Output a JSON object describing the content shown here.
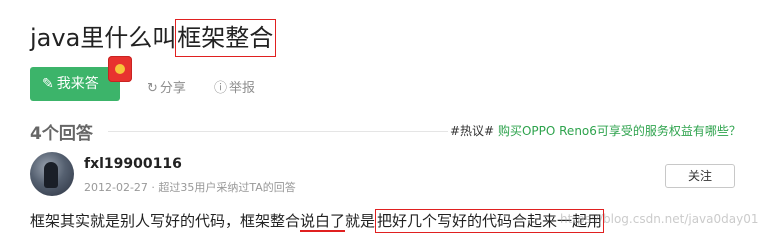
{
  "question": {
    "title_prefix": "java里什么叫",
    "title_highlight": "框架整合"
  },
  "actions": {
    "answer_label": "我来答",
    "share_label": "分享",
    "report_label": "举报"
  },
  "answers_header": {
    "count_label": "4个回答",
    "hot_tag": "#热议#",
    "hot_link": "购买OPPO Reno6可享受的服务权益有哪些？"
  },
  "answer": {
    "username": "fxl19900116",
    "meta": "2012-02-27 · 超过35用户采纳过TA的回答",
    "follow_label": "关注",
    "body_part1": "框架其实就是别人写好的代码，框架整合",
    "body_underlined": "说白了",
    "body_part2": "就是",
    "body_highlight": "把好几个写好的代码合起来一起用"
  },
  "watermark": "https://blog.csdn.net/java0day01",
  "colors": {
    "accent_green": "#3cb46a",
    "link_green": "#2ea34d",
    "annotation_red": "#e02020"
  }
}
